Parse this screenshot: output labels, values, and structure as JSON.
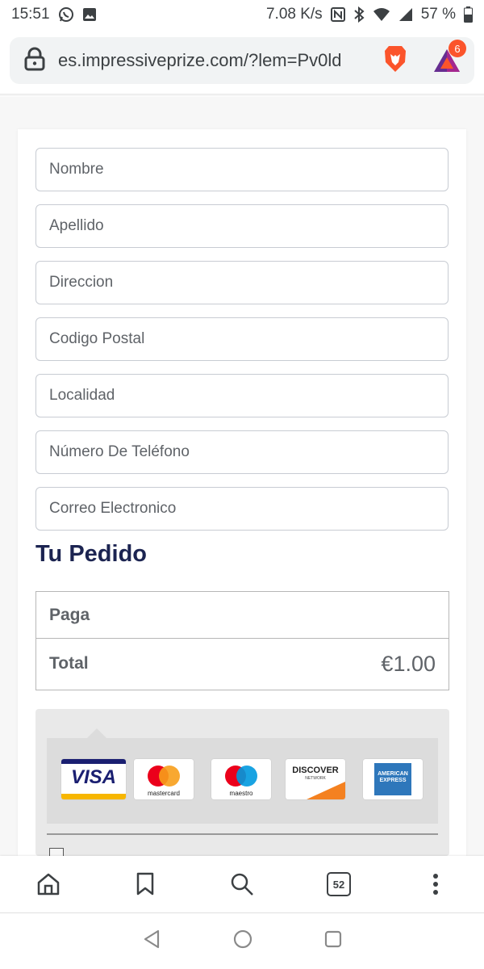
{
  "status_bar": {
    "time": "15:51",
    "net_speed": "7.08 K/s",
    "battery": "57 %"
  },
  "browser": {
    "url": "es.impressiveprize.com/?lem=Pv0ld",
    "rewards_badge": "6",
    "tabs_count": "52"
  },
  "form": {
    "fields": [
      {
        "placeholder": "Nombre"
      },
      {
        "placeholder": "Apellido"
      },
      {
        "placeholder": "Direccion"
      },
      {
        "placeholder": "Codigo Postal"
      },
      {
        "placeholder": "Localidad"
      },
      {
        "placeholder": "Número De Teléfono"
      },
      {
        "placeholder": "Correo Electronico"
      }
    ]
  },
  "order": {
    "title": "Tu Pedido",
    "pay_label": "Paga",
    "total_label": "Total",
    "total_value": "€1.00"
  },
  "payment": {
    "cards": [
      "visa",
      "mastercard",
      "maestro",
      "discover",
      "american-express"
    ],
    "visa_text": "VISA",
    "mastercard_text": "mastercard",
    "maestro_text": "maestro",
    "discover_text": "DISCOVER",
    "discover_sub": "NETWORK",
    "amex_text": "AMERICAN EXPRESS"
  },
  "colors": {
    "title": "#1c2451",
    "brave_orange": "#fb542b",
    "field_border": "#c8ccd3"
  }
}
